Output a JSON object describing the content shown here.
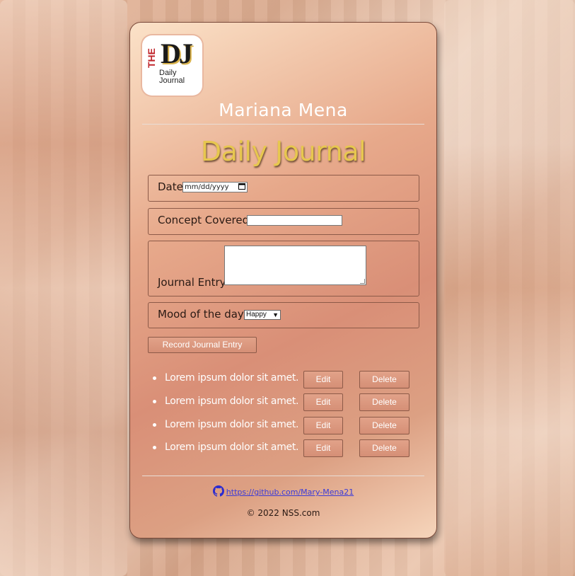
{
  "header": {
    "logo_the": "THE",
    "logo_dj": "DJ",
    "logo_sub": "Daily Journal",
    "author": "Mariana Mena"
  },
  "title": "Daily Journal",
  "form": {
    "date_label": "Date",
    "date_value": "mm/dd/yyyy",
    "concept_label": "Concept Covered",
    "concept_value": "",
    "entry_label": "Journal Entry",
    "entry_value": "",
    "mood_label": "Mood of the day",
    "mood_selected": "Happy",
    "submit_label": "Record Journal Entry"
  },
  "entries": [
    {
      "text": "Lorem ipsum dolor sit amet.",
      "edit": "Edit",
      "delete": "Delete"
    },
    {
      "text": "Lorem ipsum dolor sit amet.",
      "edit": "Edit",
      "delete": "Delete"
    },
    {
      "text": "Lorem ipsum dolor sit amet.",
      "edit": "Edit",
      "delete": "Delete"
    },
    {
      "text": "Lorem ipsum dolor sit amet.",
      "edit": "Edit",
      "delete": "Delete"
    }
  ],
  "footer": {
    "github_url": "https://github.com/Mary-Mena21",
    "copyright": "© 2022 NSS.com"
  },
  "colors": {
    "title": "#e7c74f",
    "link": "#3b3bd8",
    "button_bg": "#d58f76"
  },
  "icons": {
    "github": "github-icon",
    "calendar": "calendar-icon",
    "chevron": "chevron-down-icon"
  }
}
